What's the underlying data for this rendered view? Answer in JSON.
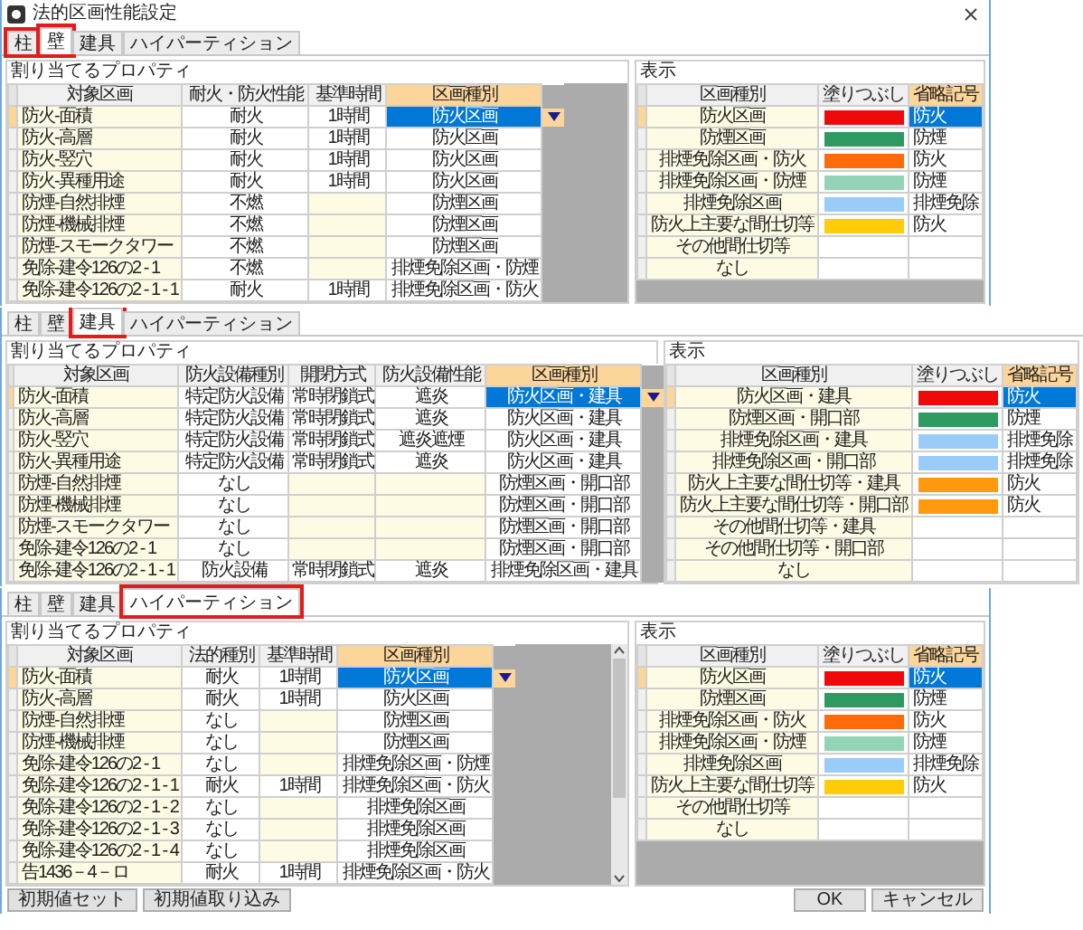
{
  "panels": [
    {
      "window": {
        "title": "法的区画性能設定"
      },
      "tabs": [
        {
          "label": "柱",
          "selected": false,
          "outlined": true
        },
        {
          "label": "壁",
          "selected": true,
          "outlined": true
        },
        {
          "label": "建具",
          "selected": false,
          "outlined": false
        },
        {
          "label": "ハイパーティション",
          "selected": false,
          "outlined": false
        }
      ],
      "properties": {
        "title": "割り当てるプロパティ",
        "columns": [
          {
            "label": "対象区画",
            "kind": "name",
            "current": false
          },
          {
            "label": "耐火・防火性能",
            "kind": "value",
            "current": false
          },
          {
            "label": "基準時間",
            "kind": "value",
            "current": false
          },
          {
            "label": "区画種別",
            "kind": "choice",
            "current": true
          }
        ],
        "rows": [
          {
            "selected": true,
            "cells": [
              "防火-面積",
              "耐火",
              "1時間",
              "防火区画"
            ]
          },
          {
            "selected": false,
            "cells": [
              "防火-高層",
              "耐火",
              "1時間",
              "防火区画"
            ]
          },
          {
            "selected": false,
            "cells": [
              "防火-竪穴",
              "耐火",
              "1時間",
              "防火区画"
            ]
          },
          {
            "selected": false,
            "cells": [
              "防火-異種用途",
              "耐火",
              "1時間",
              "防火区画"
            ]
          },
          {
            "selected": false,
            "cells": [
              "防煙-自然排煙",
              "不燃",
              null,
              "防煙区画"
            ]
          },
          {
            "selected": false,
            "cells": [
              "防煙-機械排煙",
              "不燃",
              null,
              "防煙区画"
            ]
          },
          {
            "selected": false,
            "cells": [
              "防煙-スモークタワー",
              "不燃",
              null,
              "防煙区画"
            ]
          },
          {
            "selected": false,
            "cells": [
              "免除-建令126の2 - 1",
              "不燃",
              null,
              "排煙免除区画・防煙"
            ]
          },
          {
            "selected": false,
            "cells": [
              "免除-建令126の2 - 1 - 1",
              "耐火",
              "1時間",
              "排煙免除区画・防火"
            ]
          }
        ]
      },
      "display": {
        "title": "表示",
        "columns": [
          {
            "label": "区画種別",
            "kind": "type",
            "current": false
          },
          {
            "label": "塗りつぶし",
            "kind": "fill",
            "current": false
          },
          {
            "label": "省略記号",
            "kind": "abbr",
            "current": true
          }
        ],
        "rows": [
          {
            "type": "防火区画",
            "color": "#ee0a0a",
            "abbr": "防火",
            "selected": true
          },
          {
            "type": "防煙区画",
            "color": "#2e9a62",
            "abbr": "防煙",
            "selected": false
          },
          {
            "type": "排煙免除区画・防火",
            "color": "#ff6a0a",
            "abbr": "防火",
            "selected": false
          },
          {
            "type": "排煙免除区画・防煙",
            "color": "#94d4b6",
            "abbr": "防煙",
            "selected": false
          },
          {
            "type": "排煙免除区画",
            "color": "#9accfa",
            "abbr": "排煙免除",
            "selected": false
          },
          {
            "type": "防火上主要な間仕切等",
            "color": "#ffcc0a",
            "abbr": "防火",
            "selected": false
          },
          {
            "type": "その他間仕切等",
            "selected": false
          },
          {
            "type": "なし",
            "selected": false
          }
        ]
      }
    },
    {
      "tabs": [
        {
          "label": "柱",
          "selected": false,
          "outlined": false
        },
        {
          "label": "壁",
          "selected": false,
          "outlined": false
        },
        {
          "label": "建具",
          "selected": true,
          "outlined": true
        },
        {
          "label": "ハイパーティション",
          "selected": false,
          "outlined": false
        }
      ],
      "properties": {
        "title": "割り当てるプロパティ",
        "columns": [
          {
            "label": "対象区画",
            "kind": "name",
            "current": false
          },
          {
            "label": "防火設備種別",
            "kind": "value",
            "current": false
          },
          {
            "label": "開閉方式",
            "kind": "value",
            "current": false
          },
          {
            "label": "防火設備性能",
            "kind": "value",
            "current": false
          },
          {
            "label": "区画種別",
            "kind": "choice",
            "current": true
          }
        ],
        "rows": [
          {
            "selected": true,
            "cells": [
              "防火-面積",
              "特定防火設備",
              "常時閉鎖式",
              "遮炎",
              "防火区画・建具"
            ]
          },
          {
            "selected": false,
            "cells": [
              "防火-高層",
              "特定防火設備",
              "常時閉鎖式",
              "遮炎",
              "防火区画・建具"
            ]
          },
          {
            "selected": false,
            "cells": [
              "防火-竪穴",
              "特定防火設備",
              "常時閉鎖式",
              "遮炎遮煙",
              "防火区画・建具"
            ]
          },
          {
            "selected": false,
            "cells": [
              "防火-異種用途",
              "特定防火設備",
              "常時閉鎖式",
              "遮炎",
              "防火区画・建具"
            ]
          },
          {
            "selected": false,
            "cells": [
              "防煙-自然排煙",
              "なし",
              null,
              null,
              "防煙区画・開口部"
            ]
          },
          {
            "selected": false,
            "cells": [
              "防煙-機械排煙",
              "なし",
              null,
              null,
              "防煙区画・開口部"
            ]
          },
          {
            "selected": false,
            "cells": [
              "防煙-スモークタワー",
              "なし",
              null,
              null,
              "防煙区画・開口部"
            ]
          },
          {
            "selected": false,
            "cells": [
              "免除-建令126の2 - 1",
              "なし",
              null,
              null,
              "防煙区画・開口部"
            ]
          },
          {
            "selected": false,
            "cells": [
              "免除-建令126の2 - 1 - 1",
              "防火設備",
              "常時閉鎖式",
              "遮炎",
              "排煙免除区画・建具"
            ]
          }
        ]
      },
      "display": {
        "title": "表示",
        "columns": [
          {
            "label": "区画種別",
            "kind": "type",
            "current": false
          },
          {
            "label": "塗りつぶし",
            "kind": "fill",
            "current": false
          },
          {
            "label": "省略記号",
            "kind": "abbr",
            "current": true
          }
        ],
        "rows": [
          {
            "type": "防火区画・建具",
            "color": "#ee0a0a",
            "abbr": "防火",
            "selected": true
          },
          {
            "type": "防煙区画・開口部",
            "color": "#2e9a62",
            "abbr": "防煙",
            "selected": false
          },
          {
            "type": "排煙免除区画・建具",
            "color": "#9accfa",
            "abbr": "排煙免除",
            "selected": false
          },
          {
            "type": "排煙免除区画・開口部",
            "color": "#9accfa",
            "abbr": "排煙免除",
            "selected": false
          },
          {
            "type": "防火上主要な間仕切等・建具",
            "color": "#ff9a10",
            "abbr": "防火",
            "selected": false
          },
          {
            "type": "防火上主要な間仕切等・開口部",
            "color": "#ff9a10",
            "abbr": "防火",
            "selected": false
          },
          {
            "type": "その他間仕切等・建具",
            "selected": false
          },
          {
            "type": "その他間仕切等・開口部",
            "selected": false
          },
          {
            "type": "なし",
            "selected": false
          }
        ]
      }
    },
    {
      "tabs": [
        {
          "label": "柱",
          "selected": false,
          "outlined": false
        },
        {
          "label": "壁",
          "selected": false,
          "outlined": false
        },
        {
          "label": "建具",
          "selected": false,
          "outlined": false
        },
        {
          "label": "ハイパーティション",
          "selected": true,
          "outlined": true
        }
      ],
      "properties": {
        "title": "割り当てるプロパティ",
        "scrollbar": true,
        "columns": [
          {
            "label": "対象区画",
            "kind": "name",
            "current": false
          },
          {
            "label": "法的種別",
            "kind": "value",
            "current": false
          },
          {
            "label": "基準時間",
            "kind": "value",
            "current": false
          },
          {
            "label": "区画種別",
            "kind": "choice",
            "current": true
          }
        ],
        "rows": [
          {
            "selected": true,
            "cells": [
              "防火-面積",
              "耐火",
              "1時間",
              "防火区画"
            ]
          },
          {
            "selected": false,
            "cells": [
              "防火-高層",
              "耐火",
              "1時間",
              "防火区画"
            ]
          },
          {
            "selected": false,
            "cells": [
              "防煙-自然排煙",
              "なし",
              null,
              "防煙区画"
            ]
          },
          {
            "selected": false,
            "cells": [
              "防煙-機械排煙",
              "なし",
              null,
              "防煙区画"
            ]
          },
          {
            "selected": false,
            "cells": [
              "免除-建令126の2 - 1",
              "なし",
              null,
              "排煙免除区画・防煙"
            ]
          },
          {
            "selected": false,
            "cells": [
              "免除-建令126の2 - 1 - 1",
              "耐火",
              "1時間",
              "排煙免除区画・防火"
            ]
          },
          {
            "selected": false,
            "cells": [
              "免除-建令126の2 - 1 - 2",
              "なし",
              null,
              "排煙免除区画"
            ]
          },
          {
            "selected": false,
            "cells": [
              "免除-建令126の2 - 1 - 3",
              "なし",
              null,
              "排煙免除区画"
            ]
          },
          {
            "selected": false,
            "cells": [
              "免除-建令126の2 - 1 - 4",
              "なし",
              null,
              "排煙免除区画"
            ]
          },
          {
            "selected": false,
            "cells": [
              "告1436－4－ロ",
              "耐火",
              "1時間",
              "排煙免除区画・防火"
            ]
          }
        ]
      },
      "display": {
        "title": "表示",
        "columns": [
          {
            "label": "区画種別",
            "kind": "type",
            "current": false
          },
          {
            "label": "塗りつぶし",
            "kind": "fill",
            "current": false
          },
          {
            "label": "省略記号",
            "kind": "abbr",
            "current": true
          }
        ],
        "rows": [
          {
            "type": "防火区画",
            "color": "#ee0a0a",
            "abbr": "防火",
            "selected": true
          },
          {
            "type": "防煙区画",
            "color": "#2e9a62",
            "abbr": "防煙",
            "selected": false
          },
          {
            "type": "排煙免除区画・防火",
            "color": "#ff6a0a",
            "abbr": "防火",
            "selected": false
          },
          {
            "type": "排煙免除区画・防煙",
            "color": "#94d4b6",
            "abbr": "防煙",
            "selected": false
          },
          {
            "type": "排煙免除区画",
            "color": "#9accfa",
            "abbr": "排煙免除",
            "selected": false
          },
          {
            "type": "防火上主要な間仕切等",
            "color": "#ffcc0a",
            "abbr": "防火",
            "selected": false
          },
          {
            "type": "その他間仕切等",
            "selected": false
          },
          {
            "type": "なし",
            "selected": false
          }
        ]
      },
      "buttons_left": [
        "初期値セット",
        "初期値取り込み"
      ],
      "buttons_right": [
        "OK",
        "キャンセル"
      ]
    }
  ]
}
